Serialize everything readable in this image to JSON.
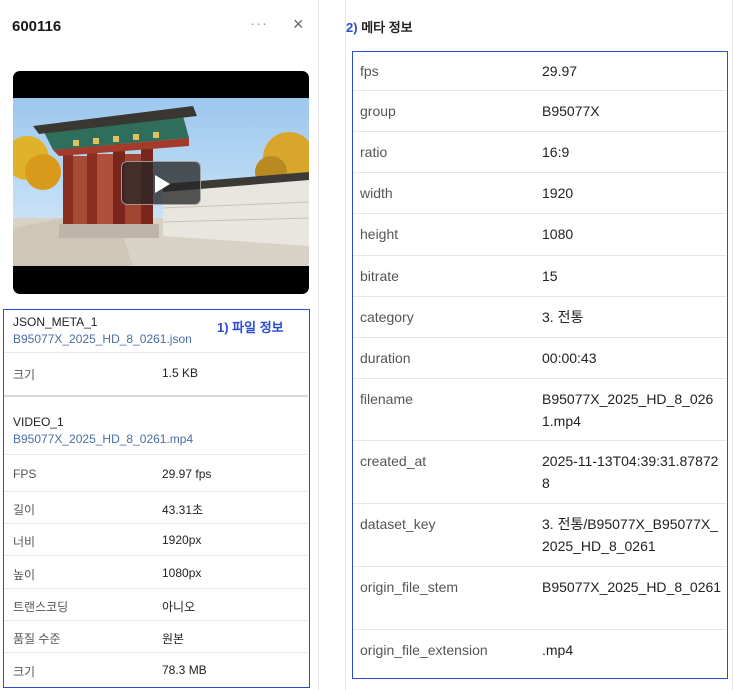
{
  "panel": {
    "title": "600116",
    "more_icon": "···",
    "close_icon": "×"
  },
  "annotations": {
    "file_info": "1) 파일 정보",
    "meta_info_num": "2)",
    "meta_info_label": "메타 정보"
  },
  "files": [
    {
      "name": "JSON_META_1",
      "path": "B95077X_2025_HD_8_0261.json",
      "rows": [
        {
          "label": "크기",
          "value": "1.5 KB"
        }
      ]
    },
    {
      "name": "VIDEO_1",
      "path": "B95077X_2025_HD_8_0261.mp4",
      "rows": [
        {
          "label": "FPS",
          "value": "29.97 fps"
        },
        {
          "label": "길이",
          "value": "43.31초"
        },
        {
          "label": "너비",
          "value": "1920px"
        },
        {
          "label": "높이",
          "value": "1080px"
        },
        {
          "label": "트랜스코딩",
          "value": "아니오"
        },
        {
          "label": "품질 수준",
          "value": "원본"
        },
        {
          "label": "크기",
          "value": "78.3 MB"
        }
      ]
    }
  ],
  "meta": [
    {
      "key": "fps",
      "value": "29.97"
    },
    {
      "key": "group",
      "value": "B95077X"
    },
    {
      "key": "ratio",
      "value": "16:9"
    },
    {
      "key": "width",
      "value": "1920"
    },
    {
      "key": "height",
      "value": "1080"
    },
    {
      "key": "bitrate",
      "value": "15"
    },
    {
      "key": "category",
      "value": "3. 전통"
    },
    {
      "key": "duration",
      "value": "00:00:43"
    },
    {
      "key": "filename",
      "value": "B95077X_2025_HD_8_0261.mp4"
    },
    {
      "key": "created_at",
      "value": "2025-11-13T04:39:31.878728"
    },
    {
      "key": "dataset_key",
      "value": "3. 전통/B95077X_B95077X_2025_HD_8_0261"
    },
    {
      "key": "origin_file_stem",
      "value": "B95077X_2025_HD_8_0261"
    },
    {
      "key": "origin_file_extension",
      "value": ".mp4"
    }
  ],
  "colors": {
    "annotation_blue": "#2b4bd6",
    "path_blue": "#4a6ea8"
  }
}
